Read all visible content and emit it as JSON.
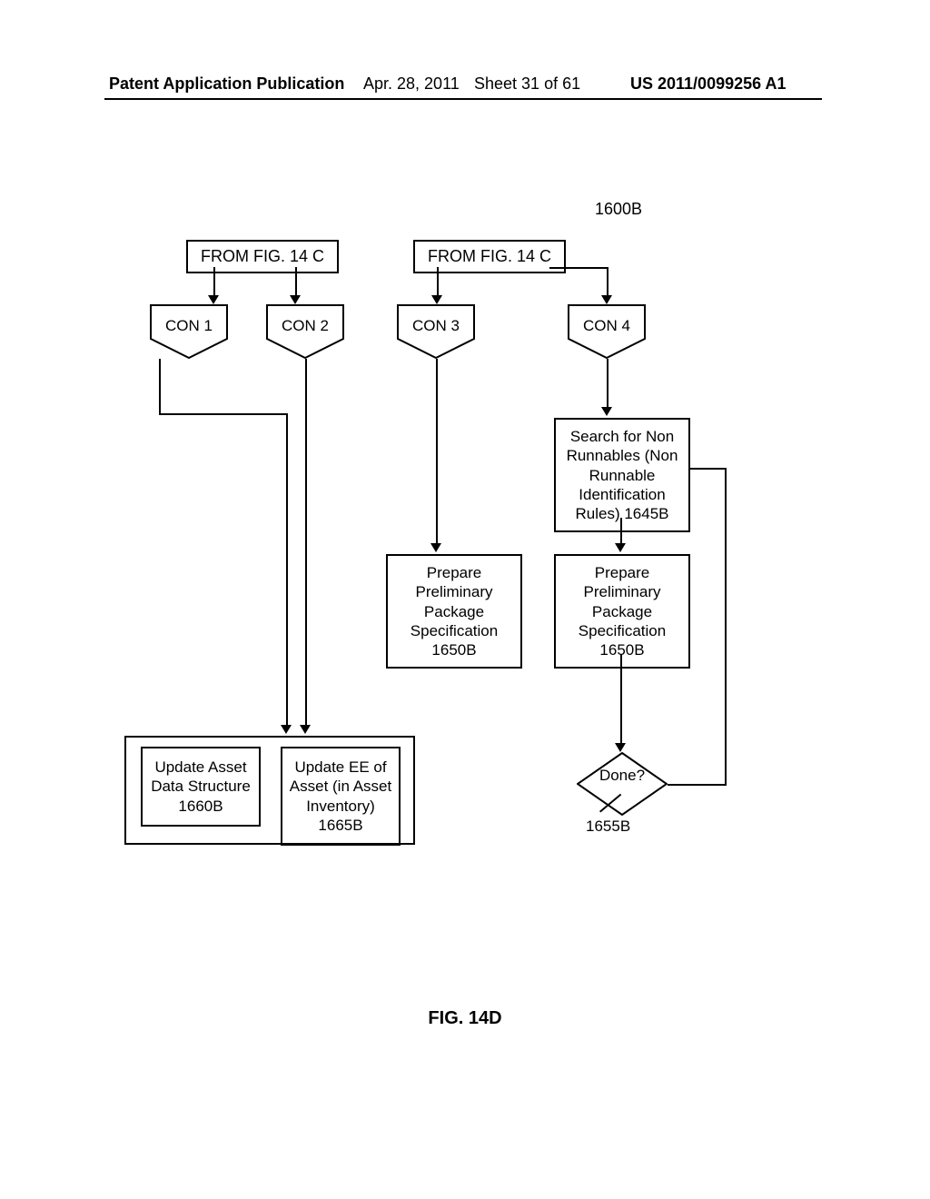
{
  "header": {
    "publication_label": "Patent Application Publication",
    "date": "Apr. 28, 2011",
    "sheet": "Sheet 31 of 61",
    "app_number": "US 2011/0099256 A1"
  },
  "ref_top": "1600B",
  "from_fig": {
    "left": "FROM FIG. 14 C",
    "right": "FROM FIG. 14 C"
  },
  "connectors": {
    "c1": "CON 1",
    "c2": "CON 2",
    "c3": "CON 3",
    "c4": "CON 4"
  },
  "boxes": {
    "search": "Search for Non Runnables (Non Runnable Identification Rules) 1645B",
    "prep3": "Prepare Preliminary Package Specification 1650B",
    "prep4": "Prepare Preliminary Package Specification 1650B",
    "update_asset": "Update Asset Data Structure 1660B",
    "update_ee": "Update EE of Asset (in Asset Inventory) 1665B"
  },
  "decision": {
    "text": "Done?",
    "ref": "1655B"
  },
  "figure_label": "FIG. 14D"
}
